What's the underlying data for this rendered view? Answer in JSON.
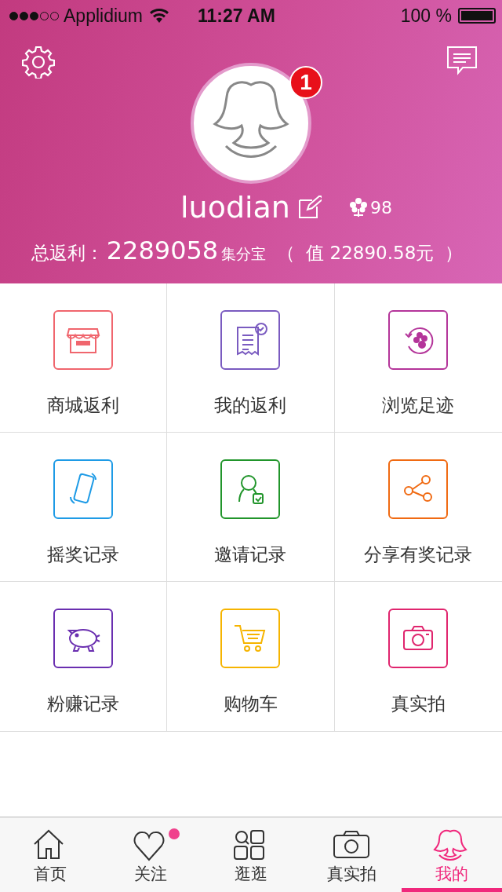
{
  "status_bar": {
    "carrier": "Applidium",
    "time": "11:27 AM",
    "battery": "100 %"
  },
  "profile": {
    "username": "luodian",
    "notification_count": "1",
    "flowers": "98",
    "rebate_label": "总返利：",
    "rebate_value": "2289058",
    "rebate_unit": "集分宝",
    "paren_open": "（",
    "worth": "值 22890.58元",
    "paren_close": "）"
  },
  "menu": [
    {
      "label": "商城返利",
      "kind": "store",
      "color": "#f0666e"
    },
    {
      "label": "我的返利",
      "kind": "receipt",
      "color": "#7a5bc0"
    },
    {
      "label": "浏览足迹",
      "kind": "footprint",
      "color": "#b4359a"
    },
    {
      "label": "摇奖记录",
      "kind": "phone",
      "color": "#1e9be6"
    },
    {
      "label": "邀请记录",
      "kind": "user",
      "color": "#21952b"
    },
    {
      "label": "分享有奖记录",
      "kind": "share",
      "color": "#f06a12"
    },
    {
      "label": "粉赚记录",
      "kind": "piggy",
      "color": "#6a2fb0"
    },
    {
      "label": "购物车",
      "kind": "cart",
      "color": "#f6b400"
    },
    {
      "label": "真实拍",
      "kind": "camera",
      "color": "#e0256e"
    }
  ],
  "tab_bar": [
    {
      "label": "首页",
      "kind": "home",
      "selected": false,
      "dot": false
    },
    {
      "label": "关注",
      "kind": "heart",
      "selected": false,
      "dot": true
    },
    {
      "label": "逛逛",
      "kind": "browse",
      "selected": false,
      "dot": false
    },
    {
      "label": "真实拍",
      "kind": "camera",
      "selected": false,
      "dot": false
    },
    {
      "label": "我的",
      "kind": "person",
      "selected": true,
      "dot": false
    }
  ]
}
